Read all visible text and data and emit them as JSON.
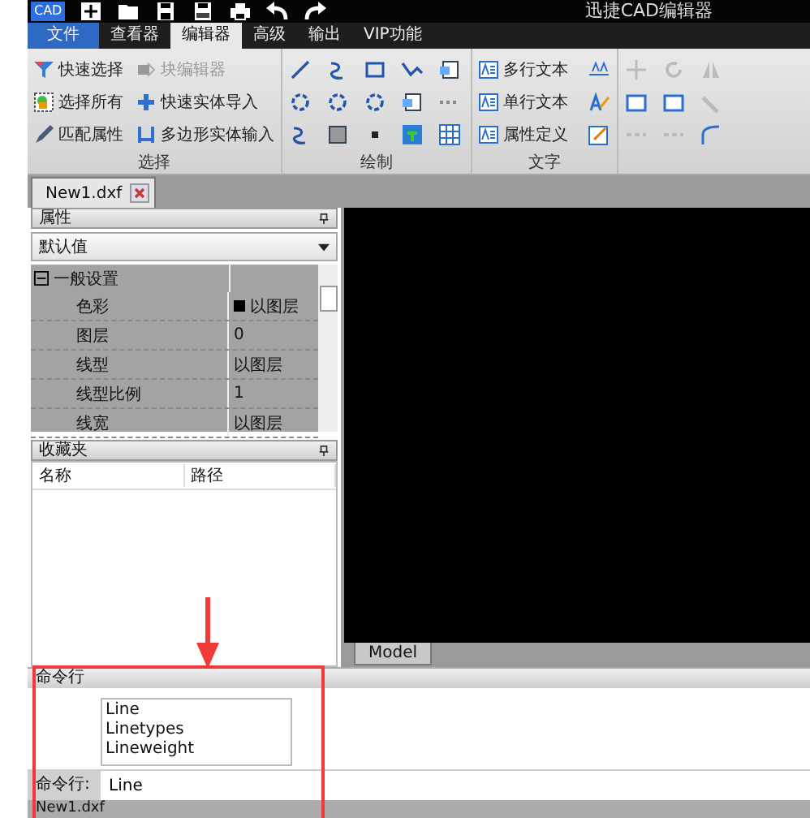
{
  "window": {
    "logo": "CAD",
    "title": "迅捷CAD编辑器"
  },
  "menu_tabs": [
    {
      "label": "文件",
      "kind": "file",
      "selected": false
    },
    {
      "label": "查看器",
      "kind": "tab",
      "selected": false
    },
    {
      "label": "编辑器",
      "kind": "tab",
      "selected": true
    },
    {
      "label": "高级",
      "kind": "tab",
      "selected": false
    },
    {
      "label": "输出",
      "kind": "tab",
      "selected": false
    },
    {
      "label": "VIP功能",
      "kind": "tab",
      "selected": false
    }
  ],
  "ribbon": {
    "select": {
      "title": "选择",
      "items": [
        {
          "label": "快速选择",
          "disabled": false
        },
        {
          "label": "选择所有",
          "disabled": false
        },
        {
          "label": "匹配属性",
          "disabled": false
        },
        {
          "label": "块编辑器",
          "disabled": true
        },
        {
          "label": "快速实体导入",
          "disabled": false
        },
        {
          "label": "多边形实体输入",
          "disabled": false
        }
      ]
    },
    "draw": {
      "title": "绘制"
    },
    "text": {
      "title": "文字",
      "items": [
        {
          "label": "多行文本",
          "disabled": false
        },
        {
          "label": "单行文本",
          "disabled": false
        },
        {
          "label": "属性定义",
          "disabled": false
        }
      ]
    }
  },
  "doc_tabs": [
    {
      "label": "New1.dxf",
      "selected": true
    }
  ],
  "properties": {
    "header": "属性",
    "dropdown": "默认值",
    "group": {
      "label": "一般设置",
      "expanded": true
    },
    "rows": [
      {
        "name": "色彩",
        "value": "以图层",
        "kind": "color"
      },
      {
        "name": "图层",
        "value": "0",
        "kind": "text"
      },
      {
        "name": "线型",
        "value": "以图层",
        "kind": "text"
      },
      {
        "name": "线型比例",
        "value": "1",
        "kind": "text"
      },
      {
        "name": "线宽",
        "value": "以图层",
        "kind": "text"
      }
    ]
  },
  "favorites": {
    "header": "收藏夹",
    "columns": [
      "名称",
      "路径"
    ]
  },
  "canvas": {
    "layout_tab": "Model"
  },
  "command": {
    "header": "命令行",
    "suggestions": [
      "Line",
      "Linetypes",
      "Lineweight"
    ],
    "prompt": "命令行:",
    "value": "Line"
  },
  "status_bar": {
    "text": "New1.dxf"
  }
}
